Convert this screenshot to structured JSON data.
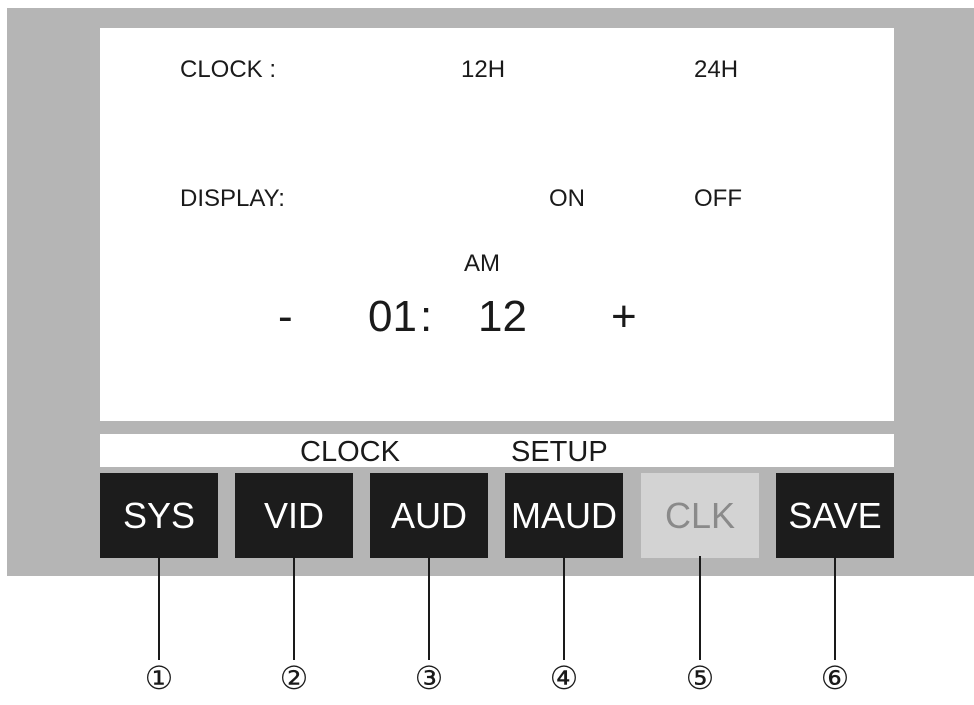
{
  "screen": {
    "clock_label": "CLOCK :",
    "clock_options": [
      "12H",
      "24H"
    ],
    "display_label": "DISPLAY:",
    "display_options": [
      "ON",
      "OFF"
    ],
    "meridiem": "AM",
    "decrement": "-",
    "hours": "01",
    "separator": ":",
    "minutes": "12",
    "increment": "+"
  },
  "menu_title": "CLOCK        SETUP",
  "menu_title_words": [
    "CLOCK",
    "SETUP"
  ],
  "buttons": [
    "SYS",
    "VID",
    "AUD",
    "MAUD",
    "CLK",
    "SAVE"
  ],
  "active_button": "CLK",
  "callouts": [
    "①",
    "②",
    "③",
    "④",
    "⑤",
    "⑥"
  ],
  "colors": {
    "device_bezel": "#b5b5b5",
    "button": "#1c1c1c",
    "button_active": "#d3d3d3",
    "button_active_text": "#8a8a8a"
  }
}
